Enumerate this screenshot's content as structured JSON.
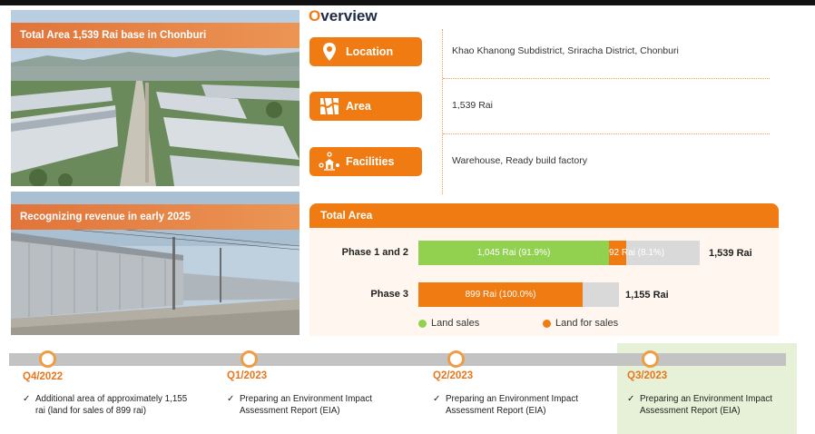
{
  "photos": {
    "top_banner": "Total Area 1,539 Rai base in Chonburi",
    "bottom_banner": "Recognizing revenue in early 2025"
  },
  "overview": {
    "title_first_letter": "O",
    "title_rest": "verview",
    "rows": [
      {
        "label": "Location",
        "icon": "map-pin-icon",
        "value": "Khao Khanong Subdistrict, Sriracha District, Chonburi"
      },
      {
        "label": "Area",
        "icon": "map-area-icon",
        "value": "1,539 Rai"
      },
      {
        "label": "Facilities",
        "icon": "facilities-icon",
        "value": "Warehouse, Ready build factory"
      }
    ]
  },
  "chart_data": {
    "type": "bar",
    "orientation": "horizontal",
    "stacked": true,
    "title": "Total Area",
    "categories": [
      "Phase 1 and 2",
      "Phase 3"
    ],
    "series": [
      {
        "name": "Land sales",
        "color": "#92d050",
        "values": [
          1045,
          0
        ],
        "labels": [
          "1,045 Rai (91.9%)",
          ""
        ]
      },
      {
        "name": "Land for sales",
        "color": "#ef7b12",
        "values": [
          92,
          899
        ],
        "labels": [
          "92 Rai (8.1%)",
          "899 Rai (100.0%)"
        ]
      }
    ],
    "totals": [
      "1,539 Rai",
      "1,155 Rai"
    ],
    "legend_position": "bottom"
  },
  "timeline": {
    "items": [
      {
        "quarter": "Q4/2022",
        "text": "Additional area of approximately 1,155 rai (land for sales of 899 rai)"
      },
      {
        "quarter": "Q1/2023",
        "text": "Preparing an Environment Impact Assessment Report (EIA)"
      },
      {
        "quarter": "Q2/2023",
        "text": "Preparing an Environment Impact Assessment Report (EIA)"
      },
      {
        "quarter": "Q3/2023",
        "text": "Preparing an Environment Impact Assessment Report (EIA)",
        "highlighted": true
      }
    ],
    "check_glyph": "✓"
  },
  "colors": {
    "accent": "#ef7b12",
    "green": "#92d050",
    "highlight_bg": "#e6f1d8"
  }
}
